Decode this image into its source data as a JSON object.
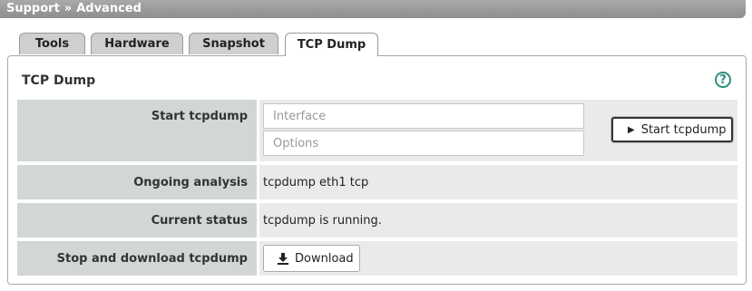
{
  "breadcrumb": {
    "root": "Support",
    "separator": "»",
    "current": "Advanced"
  },
  "tabs": [
    {
      "label": "Tools",
      "active": false
    },
    {
      "label": "Hardware",
      "active": false
    },
    {
      "label": "Snapshot",
      "active": false
    },
    {
      "label": "TCP Dump",
      "active": true
    }
  ],
  "panel": {
    "title": "TCP Dump",
    "help_icon": "help-circle-icon"
  },
  "start": {
    "label": "Start tcpdump",
    "interface_placeholder": "Interface",
    "options_placeholder": "Options",
    "button_label": "Start tcpdump",
    "button_icon": "play-icon"
  },
  "ongoing": {
    "label": "Ongoing analysis",
    "value": "tcpdump eth1 tcp"
  },
  "status": {
    "label": "Current status",
    "value": "tcpdump is running."
  },
  "stop": {
    "label": "Stop and download tcpdump",
    "button_label": "Download",
    "button_icon": "download-icon"
  }
}
